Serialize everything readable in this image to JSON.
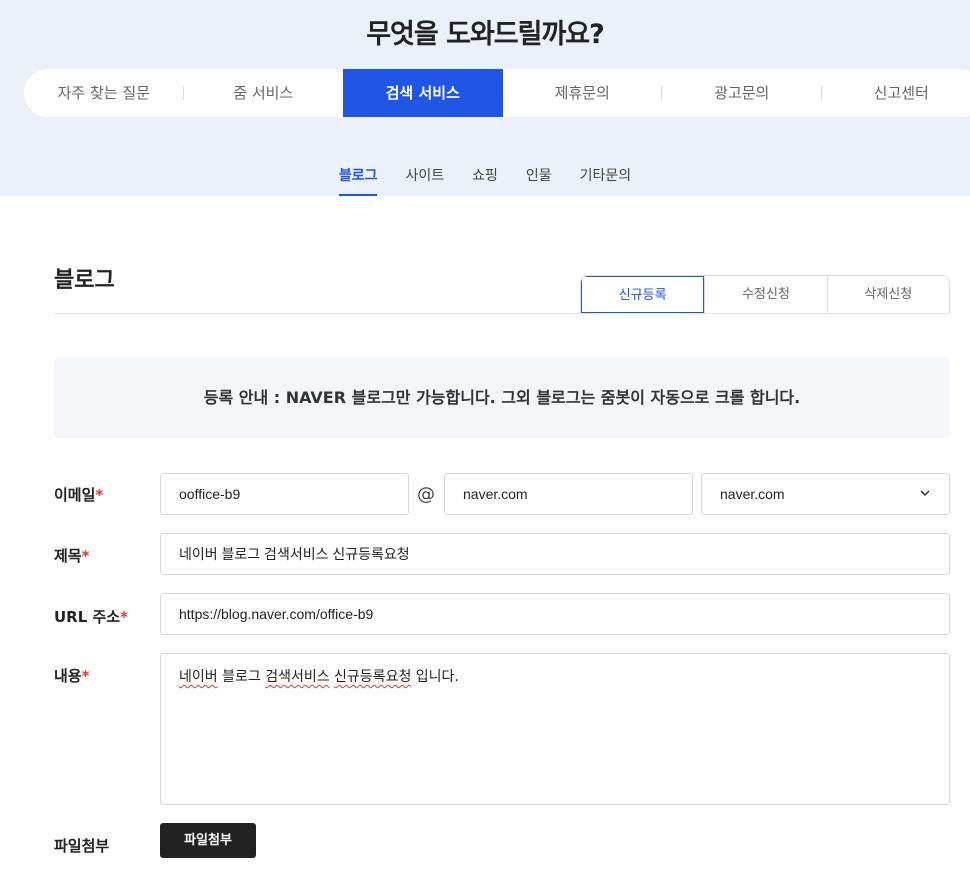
{
  "header": {
    "title": "무엇을 도와드릴까요?",
    "tabs": [
      {
        "label": "자주 찾는 질문"
      },
      {
        "label": "줌 서비스"
      },
      {
        "label": "검색 서비스"
      },
      {
        "label": "제휴문의"
      },
      {
        "label": "광고문의"
      },
      {
        "label": "신고센터"
      }
    ],
    "active_tab": "검색 서비스",
    "accent_color": "#1f56e6"
  },
  "sub_tabs": {
    "items": [
      "블로그",
      "사이트",
      "쇼핑",
      "인물",
      "기타문의"
    ],
    "active": "블로그"
  },
  "section": {
    "title": "블로그",
    "segments": [
      "신규등록",
      "수정신청",
      "삭제신청"
    ],
    "active_segment": "신규등록"
  },
  "notice": {
    "text": "등록 안내 : NAVER 블로그만 가능합니다. 그외 블로그는 줌봇이 자동으로 크롤 합니다."
  },
  "form": {
    "email": {
      "label": "이메일",
      "local_value": "ooffice-b9",
      "at": "@",
      "domain_value": "naver.com",
      "domain_select": "naver.com"
    },
    "subject": {
      "label": "제목",
      "value": "네이버 블로그 검색서비스 신규등록요청"
    },
    "url": {
      "label": "URL 주소",
      "value": "https://blog.naver.com/office-b9"
    },
    "content": {
      "label": "내용",
      "value_words": [
        "네이버",
        "블로그",
        "검색서비스",
        "신규등록요청",
        "입니다."
      ]
    },
    "attachment": {
      "label": "파일첨부",
      "button": "파일첨부"
    },
    "required_mark": "*"
  }
}
